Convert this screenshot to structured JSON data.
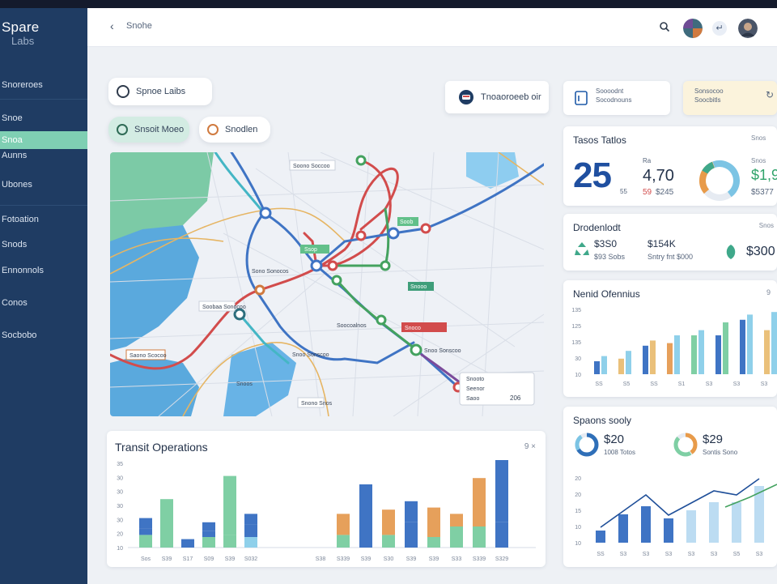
{
  "brand": {
    "line1": "Spare",
    "line2": "Labs"
  },
  "sidebar": {
    "items": [
      {
        "label": "Snoreroes",
        "active": false
      },
      {
        "label": "Snoe",
        "active": false
      },
      {
        "label": "Snoa",
        "active": true
      },
      {
        "label": "Aunns",
        "active": false
      },
      {
        "label": "Ubones",
        "active": false
      },
      {
        "label": "Fotoation",
        "active": false
      },
      {
        "label": "Snods",
        "active": false
      },
      {
        "label": "Ennonnols",
        "active": false
      },
      {
        "label": "Conos",
        "active": false
      },
      {
        "label": "Socbobo",
        "active": false
      }
    ]
  },
  "topbar": {
    "back_icon": "back-arrow-icon",
    "breadcrumb": "Snohe",
    "search_icon": "search-icon"
  },
  "header": {
    "workspace_pill": "Spnoe Laibs",
    "filter_pill_1": "Snsoit Moeo",
    "filter_pill_2": "Snodlen",
    "action_pill": "Tnoaoroeeb oir",
    "info_card_1": {
      "line1": "Soooodnt",
      "line2": "Socodnouns"
    },
    "info_card_2": {
      "line1": "Sonsocoo",
      "line2": "Soocbitls"
    }
  },
  "map": {
    "labels": [
      "Soono Soccoo",
      "Soob",
      "Ssop",
      "Sono Sonocos",
      "Snooo",
      "Soobaa Sonocoo",
      "Soocoalnos",
      "Snoco",
      "Saono Scocoo",
      "Snoo Sonscoo",
      "Snoos",
      "Snono Snos"
    ],
    "popup": {
      "line1": "Snooto",
      "line2": "Seenor",
      "line3": "Saoo",
      "value": "206"
    }
  },
  "transit": {
    "title": "Transit Operations",
    "controls": "9 ×",
    "y_ticks": [
      "35",
      "30",
      "30",
      "30",
      "30",
      "20",
      "10"
    ],
    "x_ticks": [
      "Sos",
      "S39",
      "S17",
      "S09",
      "S39",
      "S032",
      "S38",
      "S339",
      "S39",
      "S30",
      "S39",
      "S39",
      "S33",
      "S339",
      "S329"
    ]
  },
  "totals": {
    "title": "Tasos Tatlos",
    "big_value": "25",
    "big_suffix": "55",
    "mid_value": "4,70",
    "mid_prefix": "Ra",
    "mid_sub_prefix": "59",
    "mid_sub": "$245",
    "right_label": "Snos",
    "right_value": "$1,9",
    "right_sub": "$5377"
  },
  "dispatch": {
    "title": "Drodenlodt",
    "tag": "Snos",
    "value1": "$3S0",
    "value1_sub": "$93 Sobs",
    "value2": "$154K",
    "value2_sub": "Sntry fnt $000",
    "value3": "$300"
  },
  "ridership": {
    "title": "Nenid Ofennius",
    "y_ticks": [
      "135",
      "125",
      "135",
      "30",
      "10"
    ],
    "x_ticks": [
      "SS",
      "S5",
      "SS",
      "S1",
      "S3",
      "S3",
      "S3"
    ]
  },
  "summary": {
    "title": "Spaons sooly",
    "value1": "$20",
    "value1_sub": "1008 Totos",
    "value2": "$29",
    "value2_sub": "Sontis Sono",
    "y_ticks": [
      "20",
      "20",
      "15",
      "10",
      "10"
    ],
    "x_ticks": [
      "SS",
      "S3",
      "S3",
      "S3",
      "S3",
      "S3",
      "S5",
      "S3"
    ]
  },
  "colors": {
    "sidebar": "#1f3c63",
    "accent": "#7fcfb3",
    "blue": "#3f74c4",
    "green": "#7fcfa4",
    "light_blue": "#8fd0ea",
    "orange": "#e6a05b",
    "red": "#d24c4c",
    "gold": "#eac07a"
  },
  "chart_data": [
    {
      "type": "bar",
      "title": "Transit Operations",
      "series": [
        {
          "values": [
            6,
            0,
            4,
            5,
            6,
            5,
            0,
            6,
            10,
            6,
            12,
            5,
            10,
            10,
            12
          ]
        },
        {
          "values": [
            3,
            23,
            0,
            3,
            28,
            6,
            0,
            0,
            0,
            12,
            0,
            5,
            0,
            0,
            0
          ]
        },
        {
          "values": [
            5,
            0,
            0,
            4,
            0,
            5,
            0,
            0,
            0,
            0,
            0,
            0,
            0,
            0,
            0
          ]
        },
        {
          "values": [
            0,
            0,
            0,
            0,
            0,
            0,
            0,
            10,
            20,
            0,
            10,
            9,
            6,
            23,
            30
          ]
        }
      ],
      "categories": [
        "Sos",
        "S39",
        "S17",
        "S09",
        "S39",
        "S032",
        "S38",
        "S339",
        "S39",
        "S30",
        "S39",
        "S39",
        "S33",
        "S339",
        "S329"
      ]
    },
    {
      "type": "bar",
      "title": "Nenid Ofennius",
      "categories": [
        "SS",
        "S5",
        "SS",
        "S1",
        "S3",
        "S3",
        "S3"
      ],
      "series": [
        {
          "values": [
            10,
            12,
            22,
            24,
            30,
            30,
            42,
            34
          ]
        },
        {
          "values": [
            14,
            18,
            26,
            30,
            34,
            40,
            46,
            48
          ]
        }
      ]
    },
    {
      "type": "bar",
      "title": "Spaons sooly",
      "categories": [
        "SS",
        "S3",
        "S3",
        "S3",
        "S3",
        "S3",
        "S5",
        "S3"
      ],
      "series": [
        {
          "values": [
            3,
            7,
            9,
            6,
            8,
            10,
            10,
            14
          ]
        },
        {
          "values": [
            3,
            7,
            11,
            6,
            9,
            12,
            11,
            15
          ]
        }
      ]
    }
  ]
}
